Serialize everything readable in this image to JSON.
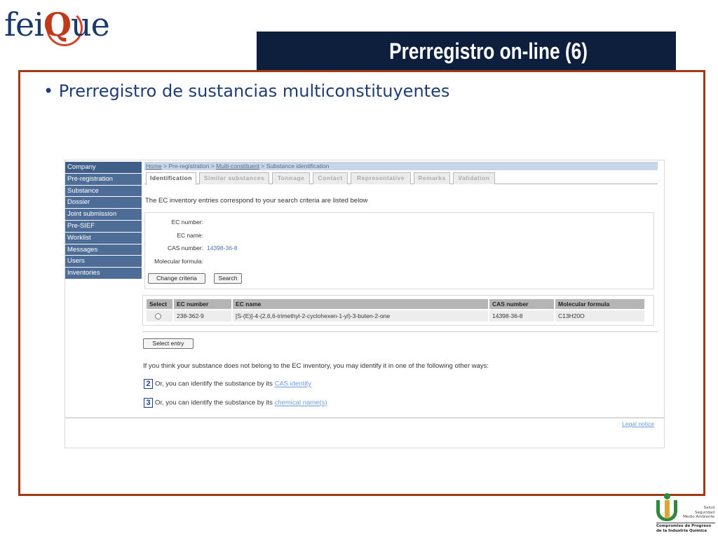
{
  "slide": {
    "logo_prefix": "fei",
    "logo_q": "Q",
    "logo_suffix": "ue",
    "title": "Prerregistro on-line (6)",
    "bullet": "Prerregistro de sustancias multiconstituyentes",
    "badge_words": [
      "Salud",
      "Seguridad",
      "Medio Ambiente"
    ],
    "badge_footer": [
      "Compromiso de Progreso",
      "de la Industria Química"
    ],
    "colors": {
      "title_bar": "#0d1f3c",
      "frame": "#a23a15",
      "bullet_text": "#1f3d73"
    }
  },
  "app": {
    "nav": [
      "Company",
      "Pre-registration",
      "Substance",
      "Dossier",
      "Joint submission",
      "Pre-SIEF",
      "Worklist",
      "Messages",
      "Users",
      "Inventories"
    ],
    "breadcrumb": {
      "home": "Home",
      "sep1": " > ",
      "prereg": "Pre-registration",
      "sep2": " > ",
      "multi": "Multi-constituent",
      "sep3": " > ",
      "current": "Substance identification"
    },
    "tabs": [
      "Identification",
      "Similar substances",
      "Tonnage",
      "Contact",
      "Representative",
      "Remarks",
      "Validation"
    ],
    "active_tab": "Identification",
    "intro": "The EC inventory entries correspond to your search criteria are listed below",
    "criteria": {
      "ec_number_label": "EC number:",
      "ec_name_label": "EC name:",
      "cas_label": "CAS number:",
      "cas_value": "14398-36-8",
      "formula_label": "Molecular formula:"
    },
    "change_criteria": "Change criteria",
    "search": "Search",
    "table": {
      "headers": [
        "Select",
        "EC number",
        "EC name",
        "CAS number",
        "Molecular formula"
      ],
      "rows": [
        {
          "ec_number": "238-362-9",
          "ec_name": "[S-(E)]-4-(2,6,6-trimethyl-2-cyclohexen-1-yl)-3-buten-2-one",
          "cas": "14398-36-8",
          "formula": "C13H20O"
        }
      ]
    },
    "select_entry": "Select entry",
    "alt_text": "If you think your substance does not belong to the EC inventory, you may identify it in one of the following other ways:",
    "options": [
      {
        "num": "2",
        "text": "Or, you can identify the substance by its ",
        "link": "CAS identity"
      },
      {
        "num": "3",
        "text": "Or, you can identify the substance by its ",
        "link": "chemical name(s)"
      }
    ],
    "legal": "Legal notice",
    "colors": {
      "nav_bg": "#4e6d96",
      "link": "#6a9be0"
    }
  }
}
